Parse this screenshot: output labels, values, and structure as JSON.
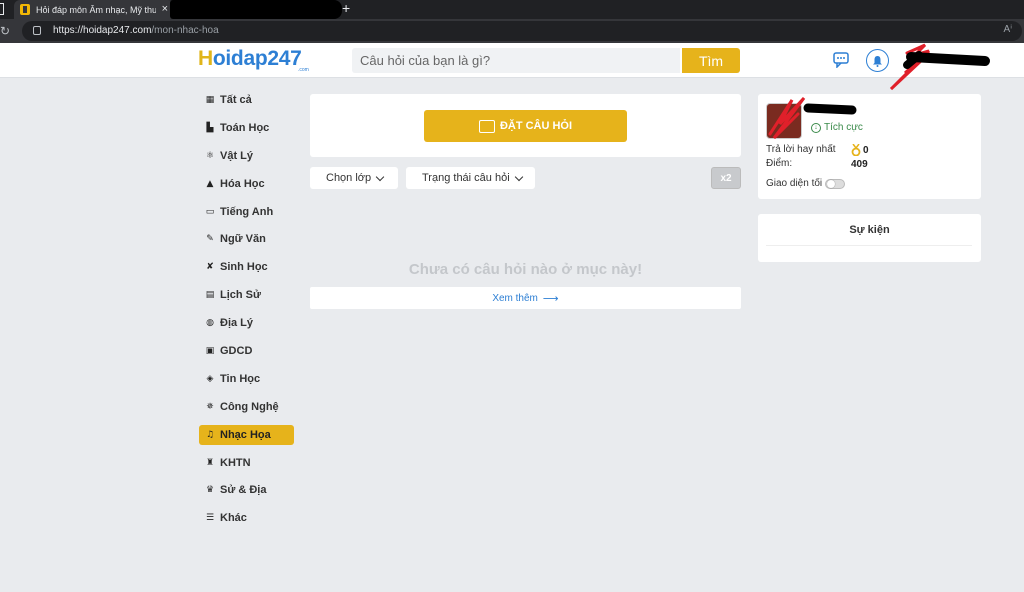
{
  "browser": {
    "tab_title": "Hỏi đáp môn Âm nhạc, Mỹ thuật",
    "url_host": "https://hoidap247.com",
    "url_path": "/mon-nhac-hoa"
  },
  "header": {
    "logo_h": "H",
    "logo_rest": "oidap247",
    "logo_sub": ".com",
    "search_placeholder": "Câu hỏi của bạn là gì?",
    "search_button": "Tìm"
  },
  "sidebar": {
    "items": [
      {
        "label": "Tất cả",
        "icon": "grid-icon",
        "glyph": "▦"
      },
      {
        "label": "Toán Học",
        "icon": "math-icon",
        "glyph": "▙"
      },
      {
        "label": "Vật Lý",
        "icon": "atom-icon",
        "glyph": "⚛"
      },
      {
        "label": "Hóa Học",
        "icon": "flask-icon",
        "glyph": "▲"
      },
      {
        "label": "Tiếng Anh",
        "icon": "keyboard-icon",
        "glyph": "▭"
      },
      {
        "label": "Ngữ Văn",
        "icon": "quill-icon",
        "glyph": "✎"
      },
      {
        "label": "Sinh Học",
        "icon": "dna-icon",
        "glyph": "✘"
      },
      {
        "label": "Lịch Sử",
        "icon": "scroll-icon",
        "glyph": "▤"
      },
      {
        "label": "Địa Lý",
        "icon": "globe-icon",
        "glyph": "◍"
      },
      {
        "label": "GDCD",
        "icon": "book-icon",
        "glyph": "▣"
      },
      {
        "label": "Tin Học",
        "icon": "code-icon",
        "glyph": "◈"
      },
      {
        "label": "Công Nghệ",
        "icon": "robot-icon",
        "glyph": "✵"
      },
      {
        "label": "Nhạc Họa",
        "icon": "music-icon",
        "glyph": "♫"
      },
      {
        "label": "KHTN",
        "icon": "microscope-icon",
        "glyph": "♜"
      },
      {
        "label": "Sử & Địa",
        "icon": "history-icon",
        "glyph": "♛"
      },
      {
        "label": "Khác",
        "icon": "list-icon",
        "glyph": "☰"
      }
    ],
    "active_index": 12
  },
  "main": {
    "ask_button": "ĐẶT CÂU HỎI",
    "filter_class": "Chọn lớp",
    "filter_status": "Trạng thái câu hỏi",
    "x2_label": "x2",
    "empty_message": "Chưa có câu hỏi nào ở mục này!",
    "see_more": "Xem thêm",
    "see_more_arrow": "⟶"
  },
  "profile": {
    "badge": "Tích cực",
    "best_answers_label": "Trả lời hay nhất",
    "best_answers_value": "0",
    "points_label": "Điểm:",
    "points_value": "409",
    "dark_mode_label": "Giao diện tối"
  },
  "events": {
    "title": "Sự kiện"
  },
  "colors": {
    "accent": "#e6b31b",
    "brand_blue": "#2d7fd4",
    "background": "#e9ebee"
  }
}
